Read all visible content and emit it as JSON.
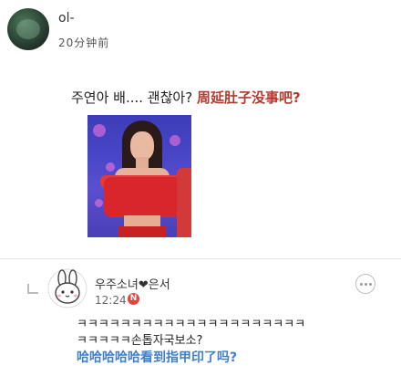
{
  "post": {
    "username": "ol-",
    "time": "20分钟前",
    "caption_korean": "주연아 배.... 괜찮아?",
    "caption_chinese": "周延肚子没事吧?"
  },
  "comment": {
    "username": "우주소녀",
    "heart": "❤",
    "username_suffix": "은서",
    "time": "12:24",
    "new_badge": "N",
    "line1": "ㅋㅋㅋㅋㅋㅋㅋㅋㅋㅋㅋㅋㅋㅋㅋㅋㅋㅋㅋㅋㅋ",
    "line2": "ㅋㅋㅋㅋㅋ손톱자국보소?",
    "line3": "哈哈哈哈哈看到指甲印了吗?"
  },
  "colors": {
    "caption_red": "#b23a2e",
    "translation_blue": "#3f7fc9",
    "badge_red": "#e8423c"
  },
  "icons": {
    "reply": "reply-arrow-icon",
    "more": "more-dots-icon"
  }
}
